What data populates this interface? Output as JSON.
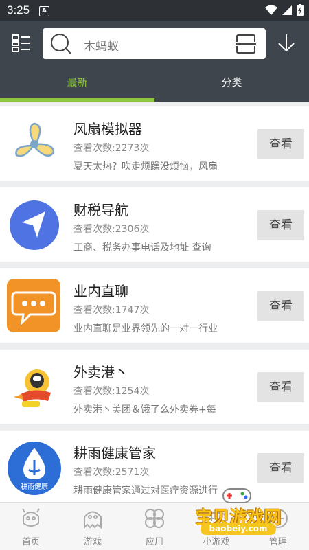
{
  "status_bar": {
    "time": "3:25",
    "notification_letter": "A"
  },
  "search": {
    "placeholder": "木蚂蚁"
  },
  "tabs": [
    {
      "label": "最新",
      "active": true
    },
    {
      "label": "分类",
      "active": false
    }
  ],
  "colors": {
    "accent": "#8cc63f",
    "header": "#3e454c",
    "statusbar": "#2d3135"
  },
  "apps": [
    {
      "name": "风扇模拟器",
      "views": "查看次数:2273次",
      "desc": "夏天太热？吹走烦躁没烦恼，风扇",
      "icon": "fan-icon",
      "button": "查看"
    },
    {
      "name": "财税导航",
      "views": "查看次数:2306次",
      "desc": "工商、税务办事电话及地址 查询",
      "icon": "navigation-arrow-icon",
      "button": "查看"
    },
    {
      "name": "业内直聊",
      "views": "查看次数:1747次",
      "desc": "业内直聊是业界领先的一对一行业",
      "icon": "chat-bubble-icon",
      "button": "查看"
    },
    {
      "name": "外卖港丶",
      "views": "查看次数:1254次",
      "desc": "外卖港丶美团＆饿了么外卖券+每",
      "icon": "rocket-icon",
      "button": "查看"
    },
    {
      "name": "耕雨健康管家",
      "views": "查看次数:2571次",
      "desc": "耕雨健康管家通过对医疗资源进行",
      "icon": "water-drop-icon",
      "button": "查看",
      "icon_text": "耕雨健康"
    }
  ],
  "bottom_nav": [
    {
      "label": "首页",
      "icon": "robot-icon"
    },
    {
      "label": "游戏",
      "icon": "ghost-icon"
    },
    {
      "label": "应用",
      "icon": "apps-icon"
    },
    {
      "label": "小游戏",
      "icon": "gamepad-icon"
    },
    {
      "label": "管理",
      "icon": "manage-icon"
    }
  ],
  "watermark": {
    "title": "宝贝游戏网",
    "url": "baobeiy.com"
  }
}
